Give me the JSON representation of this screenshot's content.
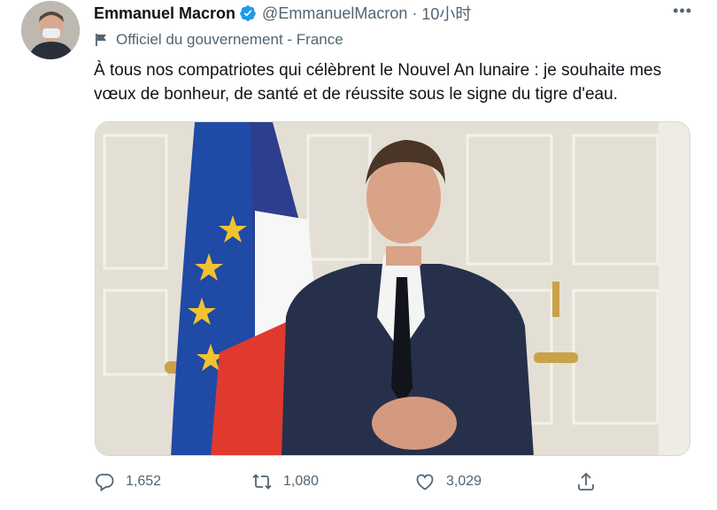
{
  "tweet": {
    "author_name": "Emmanuel Macron",
    "handle": "@EmmanuelMacron",
    "separator": "·",
    "time": "10小时",
    "more_label": "•••",
    "label": "Officiel du gouvernement - France",
    "text": "À tous nos compatriotes qui célèbrent le Nouvel An lunaire : je souhaite mes vœux de bonheur, de santé et de réussite sous le signe du tigre d'eau."
  },
  "actions": {
    "replies": "1,652",
    "retweets": "1,080",
    "likes": "3,029"
  },
  "colors": {
    "verified": "#1d9bf0",
    "text": "#0f1419",
    "secondary": "#536471",
    "border": "#cfd9de"
  },
  "icons": [
    "verified-badge-icon",
    "government-flag-icon",
    "reply-icon",
    "retweet-icon",
    "like-icon",
    "share-icon"
  ]
}
